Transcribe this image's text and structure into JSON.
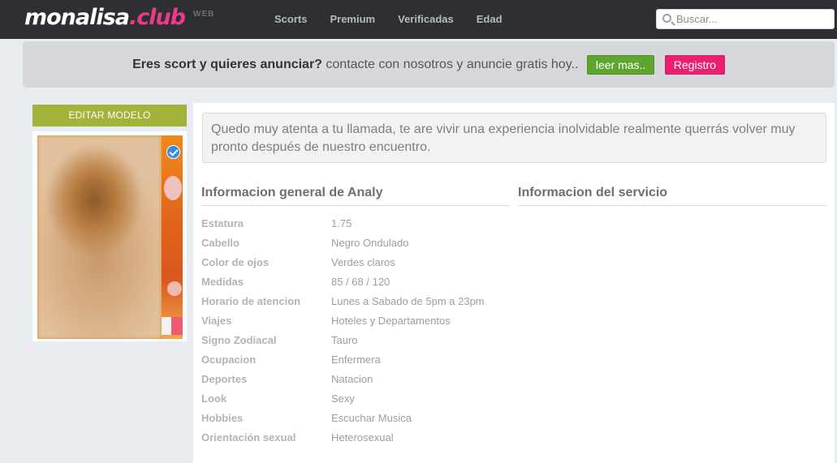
{
  "header": {
    "logo_main": "monalisa",
    "logo_accent": ".club",
    "logo_web": "WEB",
    "nav": [
      "Scorts",
      "Premium",
      "Verificadas",
      "Edad"
    ],
    "search_placeholder": "Buscar..."
  },
  "banner": {
    "strong": "Eres scort y quieres anunciar?",
    "light": "contacte con nosotros y anuncie gratis hoy..",
    "more_label": "leer mas..",
    "register_label": "Registro"
  },
  "sidebar": {
    "edit_label": "EDITAR MODELO"
  },
  "profile": {
    "description": "Quedo muy atenta a tu llamada, te are vivir una experiencia inolvidable realmente querrás volver muy pronto después de nuestro encuentro.",
    "general_title": "Informacion general de Analy",
    "service_title": "Informacion del servicio",
    "info": [
      {
        "label": "Estatura",
        "value": "1.75"
      },
      {
        "label": "Cabello",
        "value": "Negro Ondulado"
      },
      {
        "label": "Color de ojos",
        "value": "Verdes claros"
      },
      {
        "label": "Medidas",
        "value": "85 / 68 / 120"
      },
      {
        "label": "Horario de atencion",
        "value": "Lunes a Sabado de 5pm a 23pm"
      },
      {
        "label": "Viajes",
        "value": "Hoteles y Departamentos"
      },
      {
        "label": "Signo Zodiacal",
        "value": "Tauro"
      },
      {
        "label": "Ocupacion",
        "value": "Enfermera"
      },
      {
        "label": "Deportes",
        "value": "Natacion"
      },
      {
        "label": "Look",
        "value": "Sexy"
      },
      {
        "label": "Hobbies",
        "value": "Escuchar Musica"
      },
      {
        "label": "Orientación sexual",
        "value": "Heterosexual"
      }
    ]
  },
  "colors": {
    "topbar": "#2d2f33",
    "accent_pink": "#ec3a8a",
    "edit_button": "#a3b238",
    "more_button": "#5fa630",
    "register_button": "#ec1f6f",
    "verified_badge": "#2e8de4"
  },
  "icons": {
    "search": "search-icon",
    "verified": "verified-check-icon"
  }
}
